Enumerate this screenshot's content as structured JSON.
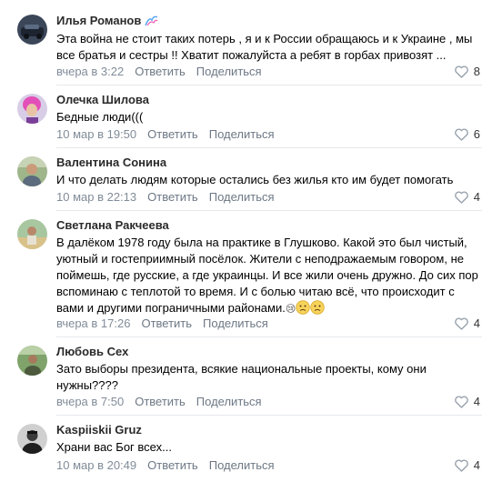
{
  "comments": [
    {
      "author": "Илья Романов",
      "text": "Эта война не стоит таких потерь , я и к России обращаюсь и к Украине , мы все братья и сестры !! Хватит пожалуйста а ребят в горбах привозят ...",
      "time": "вчера в 3:22",
      "reply": "Ответить",
      "share": "Поделиться",
      "likes": "8"
    },
    {
      "author": "Олечка Шилова",
      "text": "Бедные люди(((",
      "time": "10 мар в 19:50",
      "reply": "Ответить",
      "share": "Поделиться",
      "likes": "6"
    },
    {
      "author": "Валентина Сонина",
      "text": "И что делать людям которые остались без жилья кто им будет помогать",
      "time": "10 мар в 22:13",
      "reply": "Ответить",
      "share": "Поделиться",
      "likes": "4"
    },
    {
      "author": "Светлана Ракчеева",
      "text": "В далёком 1978 году была на практике в Глушково. Какой это был чистый, уютный и гостеприимный посёлок. Жители с неподражаемым говором, не поймешь, где русские, а где украинцы. И все жили очень дружно. До сих пор вспоминаю с теплотой то время. И с болью читаю всё, что происходит с вами и другими пограничными районами.",
      "emoji_glyph": "😢",
      "time": "вчера в 17:26",
      "reply": "Ответить",
      "share": "Поделиться",
      "likes": "4"
    },
    {
      "author": "Любовь Сех",
      "text": "Зато выборы президента, всякие национальные проекты, кому они нужны????",
      "time": "вчера в 7:50",
      "reply": "Ответить",
      "share": "Поделиться",
      "likes": "4"
    },
    {
      "author": "Kaspiiskii Gruz",
      "text": "Храни вас Бог всех...",
      "time": "10 мар в 20:49",
      "reply": "Ответить",
      "share": "Поделиться",
      "likes": "4"
    }
  ],
  "colors": {
    "meta": "#818c99",
    "action": "#6d7885",
    "divider": "#e7e8ec"
  }
}
